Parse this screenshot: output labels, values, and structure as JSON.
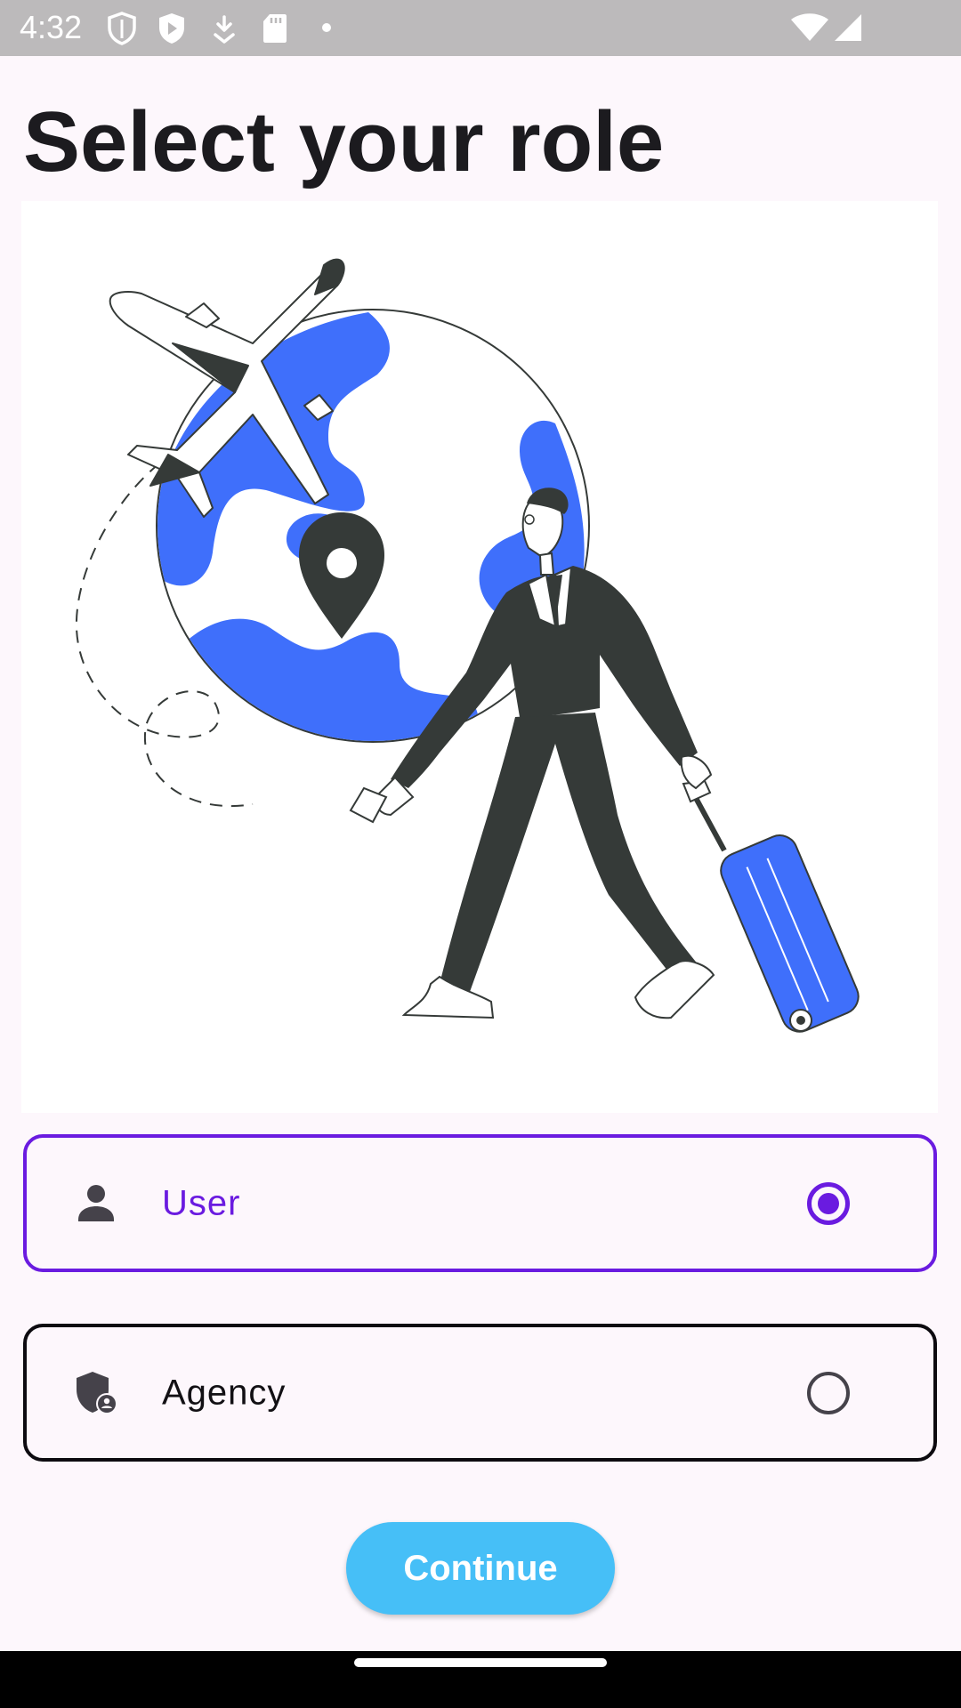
{
  "status_bar": {
    "time": "4:32",
    "left_icons": [
      "shield-outline-icon",
      "play-shield-icon",
      "download-arrow-icon",
      "sd-card-icon",
      "dot-icon"
    ],
    "right_icons": [
      "wifi-icon",
      "cellular-signal-icon"
    ]
  },
  "page": {
    "title": "Select your role"
  },
  "illustration": {
    "name": "traveler-illustration",
    "accent_color": "#3f6ffb",
    "ink_color": "#353a38"
  },
  "roles": [
    {
      "label": "User",
      "icon": "person-icon",
      "selected": true
    },
    {
      "label": "Agency",
      "icon": "admin-shield-person-icon",
      "selected": false
    }
  ],
  "actions": {
    "continue_label": "Continue"
  },
  "colors": {
    "primary": "#6a1be0",
    "button": "#46bff7",
    "background": "#fdf7fc",
    "status_bar": "#bcbabb"
  }
}
